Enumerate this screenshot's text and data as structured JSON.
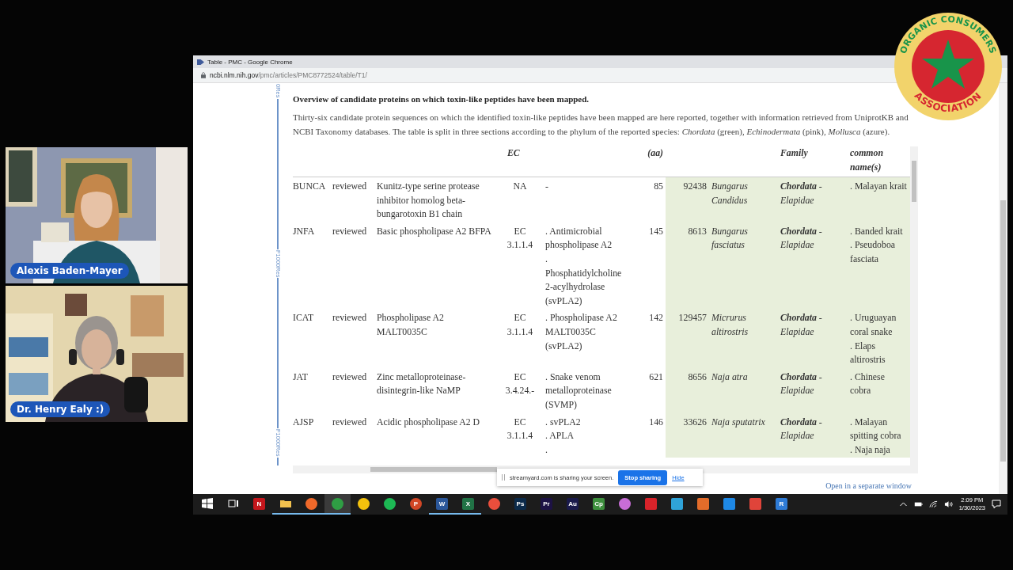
{
  "stream": {
    "participants": [
      {
        "name": "Alexis Baden-Mayer"
      },
      {
        "name": "Dr. Henry Ealy :)"
      }
    ],
    "logo": {
      "top_text": "ORGANIC CONSUMERS",
      "bottom_text": "ASSOCIATION"
    }
  },
  "browser": {
    "title": "Table - PMC - Google Chrome",
    "url_host": "ncbi.nlm.nih.gov",
    "url_path": "/pmc/articles/PMC8772524/table/T1/"
  },
  "page": {
    "side_labels": [
      "0Res",
      "F1000Res",
      "F1000Res"
    ],
    "caption": "Overview of candidate proteins on which toxin-like peptides have been mapped.",
    "description": "Thirty-six candidate protein sequences on which the identified toxin-like peptides have been mapped are here reported, together with information retrieved from UniprotKB and NCBI Taxonomy databases. The table is split in three sections according to the phylum of the reported species: *Chordata* (green), *Echinodermata* (pink), *Mollusca* (azure).",
    "table": {
      "header": {
        "ec": "EC",
        "length": "(aa)",
        "family": "Family",
        "common_names": "common name(s)"
      },
      "rows": [
        {
          "id": "BUNCA",
          "status": "reviewed",
          "protein": "Kunitz-type serine protease inhibitor homolog beta-bungarotoxin B1 chain",
          "ec": "NA",
          "ec_names": [
            "-"
          ],
          "length": "85",
          "taxid": "92438",
          "species": "Bungarus Candidus",
          "family": "**Chordata** - Elapidae",
          "common_names": [
            ". Malayan krait"
          ]
        },
        {
          "id": "JNFA",
          "status": "reviewed",
          "protein": "Basic phospholipase A2 BFPA",
          "ec": "EC 3.1.1.4",
          "ec_names": [
            ". Antimicrobial phospholipase A2",
            ".",
            "Phosphatidylcholine 2-acylhydrolase (svPLA2)"
          ],
          "length": "145",
          "taxid": "8613",
          "species": "Bungarus fasciatus",
          "family": "**Chordata** - Elapidae",
          "common_names": [
            ". Banded krait",
            ". Pseudoboa fasciata"
          ]
        },
        {
          "id": "ICAT",
          "status": "reviewed",
          "protein": "Phospholipase A2 MALT0035C",
          "ec": "EC 3.1.1.4",
          "ec_names": [
            ". Phospholipase A2 MALT0035C (svPLA2)"
          ],
          "length": "142",
          "taxid": "129457",
          "species": "Micrurus altirostris",
          "family": "**Chordata** - Elapidae",
          "common_names": [
            ". Uruguayan coral snake",
            ". Elaps altirostris"
          ]
        },
        {
          "id": "JAT",
          "status": "reviewed",
          "protein": "Zinc metalloproteinase-disintegrin-like NaMP",
          "ec": "EC 3.4.24.-",
          "ec_names": [
            ". Snake venom metalloproteinase (SVMP)"
          ],
          "length": "621",
          "taxid": "8656",
          "species": "Naja atra",
          "family": "**Chordata** - Elapidae",
          "common_names": [
            ". Chinese cobra"
          ]
        },
        {
          "id": "AJSP",
          "status": "reviewed",
          "protein": "Acidic phospholipase A2 D",
          "ec": "EC 3.1.1.4",
          "ec_names": [
            ". svPLA2",
            ". APLA",
            "."
          ],
          "length": "146",
          "taxid": "33626",
          "species": "Naja sputatrix",
          "family": "**Chordata** - Elapidae",
          "common_names": [
            ". Malayan spitting cobra",
            ". Naja naja"
          ]
        }
      ]
    },
    "link": "Open in a separate window"
  },
  "share_banner": {
    "message": "streamyard.com is sharing your screen.",
    "stop_button": "Stop sharing",
    "hide_link": "Hide"
  },
  "taskbar": {
    "apps": [
      {
        "kind": "start",
        "running": false,
        "selected": false
      },
      {
        "kind": "taskview",
        "running": false,
        "selected": false
      },
      {
        "kind": "tile",
        "label": "N",
        "color": "#c4161c",
        "running": false,
        "selected": false
      },
      {
        "kind": "folder",
        "color": "#f2c14e",
        "running": true,
        "selected": false
      },
      {
        "kind": "round",
        "color": "#f0692a",
        "running": true,
        "selected": false
      },
      {
        "kind": "round",
        "color": "#2f9e44",
        "running": true,
        "selected": true
      },
      {
        "kind": "round",
        "color": "#f4c20d",
        "running": false,
        "selected": false
      },
      {
        "kind": "round",
        "color": "#1db954",
        "running": false,
        "selected": false
      },
      {
        "kind": "round",
        "label": "P",
        "color": "#d24726",
        "running": false,
        "selected": false
      },
      {
        "kind": "tile",
        "label": "W",
        "color": "#2b579a",
        "running": true,
        "selected": false
      },
      {
        "kind": "tile",
        "label": "X",
        "color": "#217346",
        "running": true,
        "selected": false
      },
      {
        "kind": "round",
        "color": "#e94e3c",
        "running": false,
        "selected": false
      },
      {
        "kind": "tile",
        "label": "Ps",
        "color": "#0b2a4a",
        "running": false,
        "selected": false
      },
      {
        "kind": "tile",
        "label": "Pr",
        "color": "#1d1245",
        "running": false,
        "selected": false
      },
      {
        "kind": "tile",
        "label": "Au",
        "color": "#1a1a4a",
        "running": false,
        "selected": false
      },
      {
        "kind": "tile",
        "label": "Cp",
        "color": "#3d8f3d",
        "running": false,
        "selected": false
      },
      {
        "kind": "round",
        "color": "#c86dd7",
        "running": false,
        "selected": false
      },
      {
        "kind": "tile",
        "color": "#d8232a",
        "running": false,
        "selected": false
      },
      {
        "kind": "tile",
        "color": "#2fa3d8",
        "running": false,
        "selected": false
      },
      {
        "kind": "tile",
        "color": "#e36c2a",
        "running": false,
        "selected": false
      },
      {
        "kind": "tile",
        "color": "#1e88e5",
        "running": false,
        "selected": false
      },
      {
        "kind": "tile",
        "color": "#e0443a",
        "running": false,
        "selected": false
      },
      {
        "kind": "tile",
        "label": "R",
        "color": "#2e7bd6",
        "running": false,
        "selected": false
      }
    ],
    "time": "2:09 PM",
    "date": "1/30/2023"
  }
}
